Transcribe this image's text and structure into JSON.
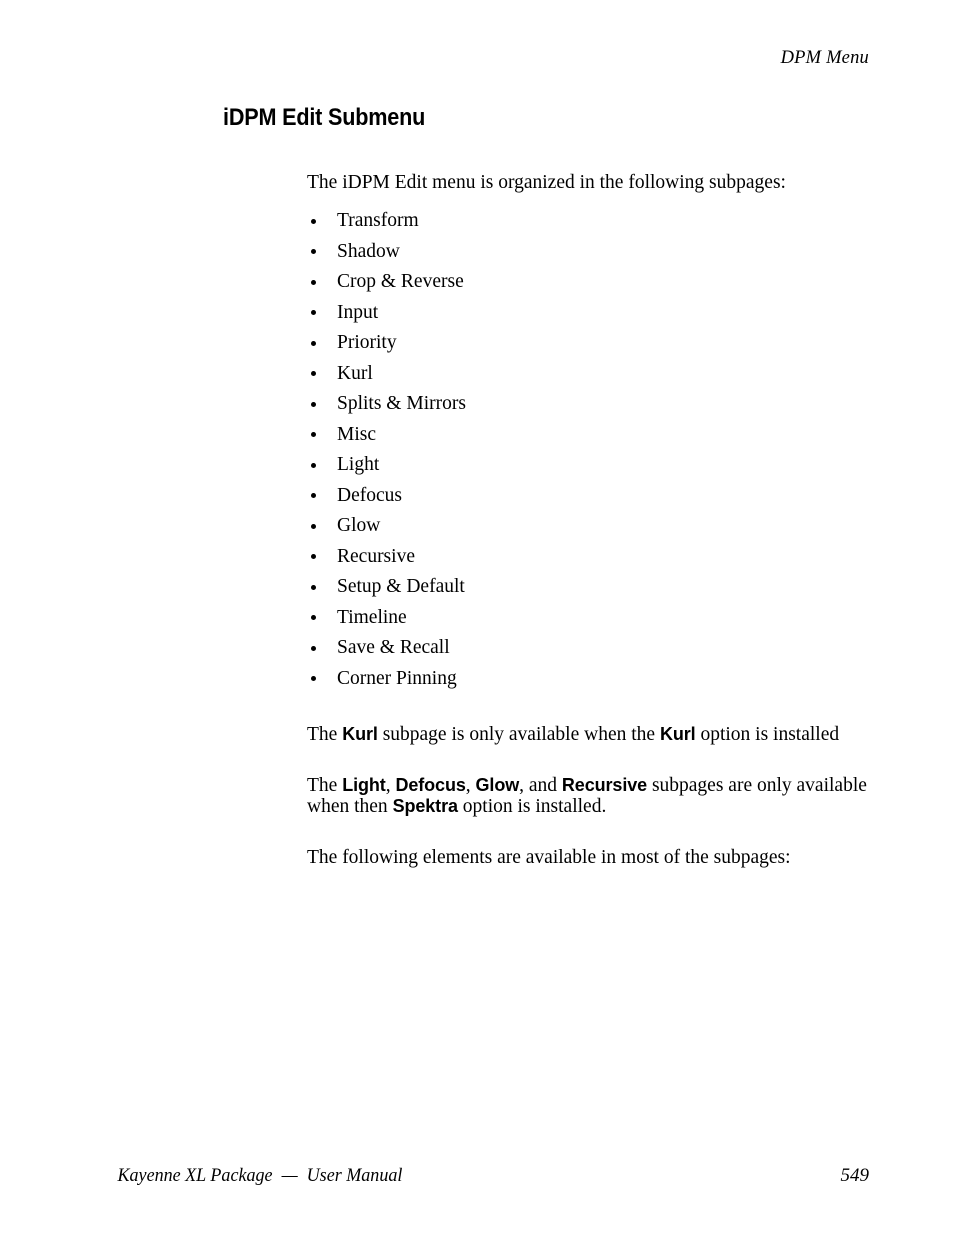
{
  "header": {
    "running_head": "DPM Menu"
  },
  "heading": {
    "title": "iDPM Edit Submenu"
  },
  "intro": {
    "text": "The iDPM Edit menu is organized in the following subpages:"
  },
  "subpages": [
    "Transform",
    "Shadow",
    "Crop & Reverse",
    "Input",
    "Priority",
    "Kurl",
    "Splits & Mirrors",
    "Misc",
    "Light",
    "Defocus",
    "Glow",
    "Recursive",
    "Setup & Default",
    "Timeline",
    "Save & Recall",
    "Corner Pinning"
  ],
  "notes": {
    "kurl": {
      "part1": "The ",
      "term1": "Kurl",
      "part2": " subpage is only available when the ",
      "term2": "Kurl",
      "part3": " option is installed"
    },
    "spektra": {
      "part1": "The ",
      "term1": "Light",
      "part2": ", ",
      "term2": "Defocus",
      "part3": ", ",
      "term3": "Glow",
      "part4": ", and ",
      "term4": "Recursive",
      "part5": " subpages are only available when then ",
      "term5": "Spektra",
      "part6": " option is installed."
    },
    "elements": {
      "text": "The following elements are available in most of the subpages:"
    }
  },
  "footer": {
    "manual_title": "Kayenne XL Package  —  User Manual",
    "page_number": "549"
  }
}
